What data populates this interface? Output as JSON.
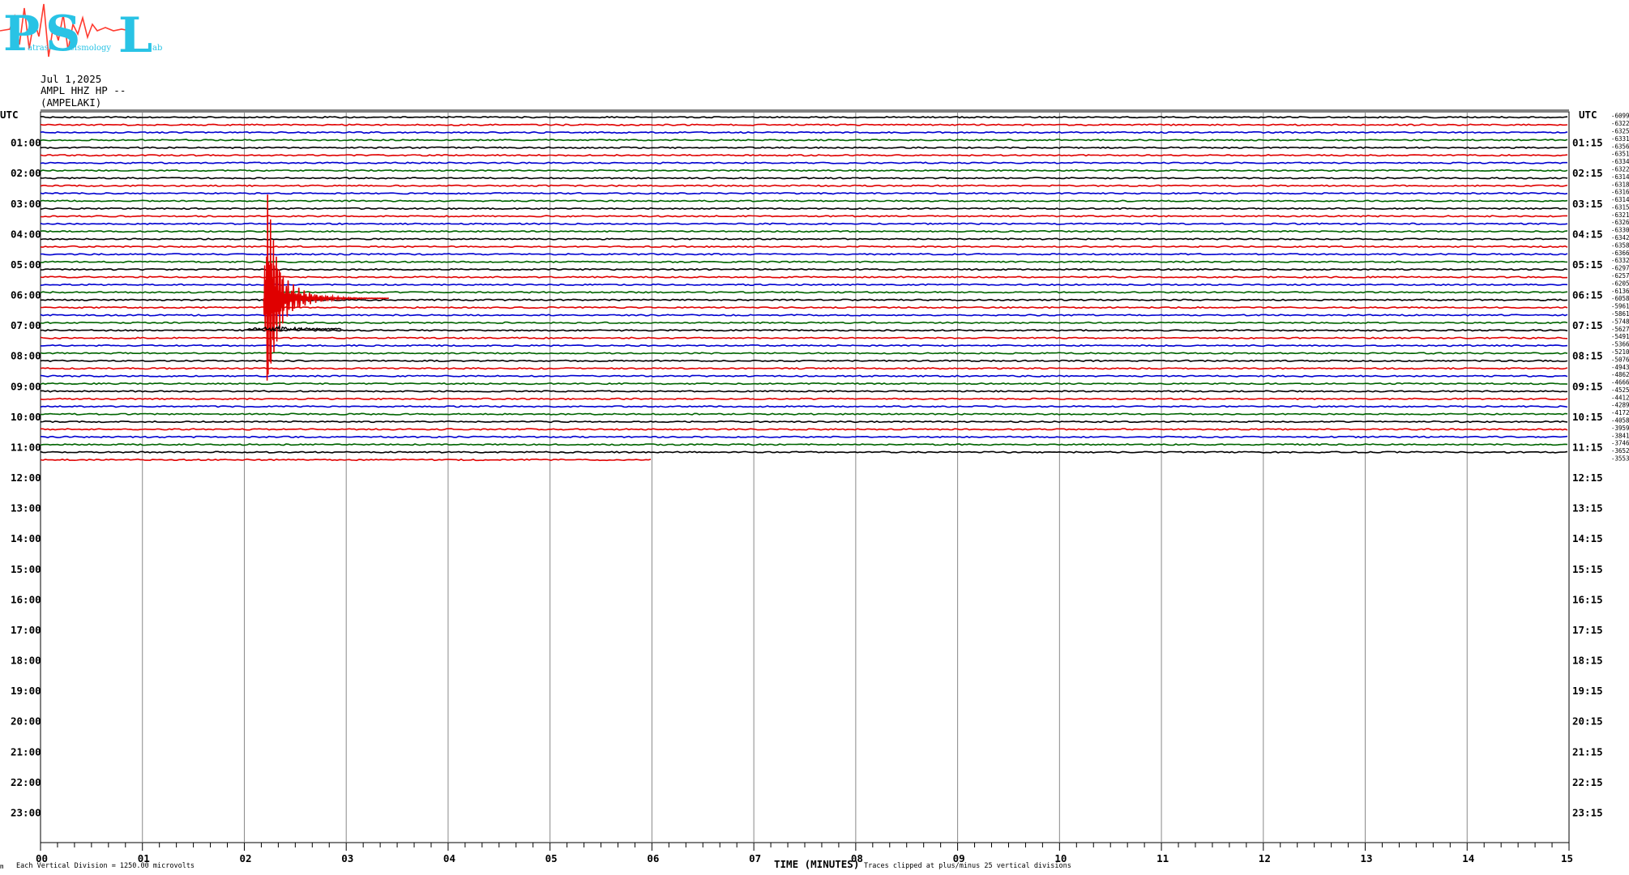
{
  "logo": {
    "letters": [
      "P",
      "S",
      "L"
    ],
    "words": [
      "atras",
      "eismology",
      "ab"
    ],
    "colors": {
      "letters": "#29c3e5",
      "squiggle": "#ff3b30"
    }
  },
  "header": {
    "date": "Jul 1,2025",
    "channel": "AMPL HHZ HP --",
    "station": "(AMPELAKI)"
  },
  "footer": {
    "scale_note": "Each Vertical Division = 1250.00 microvolts",
    "corner_mark": "m",
    "xlabel": "TIME (MINUTES)",
    "clip_note": "Traces clipped at plus/minus 25 vertical divisions"
  },
  "chart_data": {
    "type": "line",
    "title": "",
    "xlabel": "TIME (MINUTES)",
    "ylabel": "UTC",
    "axis_label_left": "UTC",
    "axis_label_right": "UTC",
    "xlim": [
      0,
      15
    ],
    "x_ticks": [
      "00",
      "01",
      "02",
      "03",
      "04",
      "05",
      "06",
      "07",
      "08",
      "09",
      "10",
      "11",
      "12",
      "13",
      "14",
      "15"
    ],
    "left_hour_labels": [
      "01:00",
      "02:00",
      "03:00",
      "04:00",
      "05:00",
      "06:00",
      "07:00",
      "08:00",
      "09:00",
      "10:00",
      "11:00",
      "12:00",
      "13:00",
      "14:00",
      "15:00",
      "16:00",
      "17:00",
      "18:00",
      "19:00",
      "20:00",
      "21:00",
      "22:00",
      "23:00"
    ],
    "right_hour_labels": [
      "01:15",
      "02:15",
      "03:15",
      "04:15",
      "05:15",
      "06:15",
      "07:15",
      "08:15",
      "09:15",
      "10:15",
      "11:15",
      "12:15",
      "13:15",
      "14:15",
      "15:15",
      "16:15",
      "17:15",
      "18:15",
      "19:15",
      "20:15",
      "21:15",
      "22:15",
      "23:15"
    ],
    "minutes_per_line": 15,
    "lines_per_hour": 4,
    "trace_colors": [
      "#000000",
      "#e00000",
      "#0000d0",
      "#006400"
    ],
    "right_offsets": [
      -6099,
      -6322,
      -6325,
      -6331,
      -6356,
      -6351,
      -6334,
      -6322,
      -6314,
      -6318,
      -6316,
      -6314,
      -6315,
      -6321,
      -6326,
      -6330,
      -6342,
      -6358,
      -6366,
      -6332,
      -6297,
      -6257,
      -6205,
      -6136,
      -6058,
      -5961,
      -5861,
      -5748,
      -5627,
      -5491,
      -5366,
      -5210,
      -5076,
      -4943,
      -4862,
      -4666,
      -4525,
      -4412,
      -4289,
      -4172,
      -4058,
      -3959,
      -3841,
      -3746,
      -3652,
      -3553
    ],
    "last_trace_end_minute": 6.0,
    "events": [
      {
        "line": 24,
        "minute": 2.27,
        "amplitude": 185,
        "color": "#e00000",
        "desc": "main clipped earthquake signal"
      }
    ],
    "grid": true
  }
}
